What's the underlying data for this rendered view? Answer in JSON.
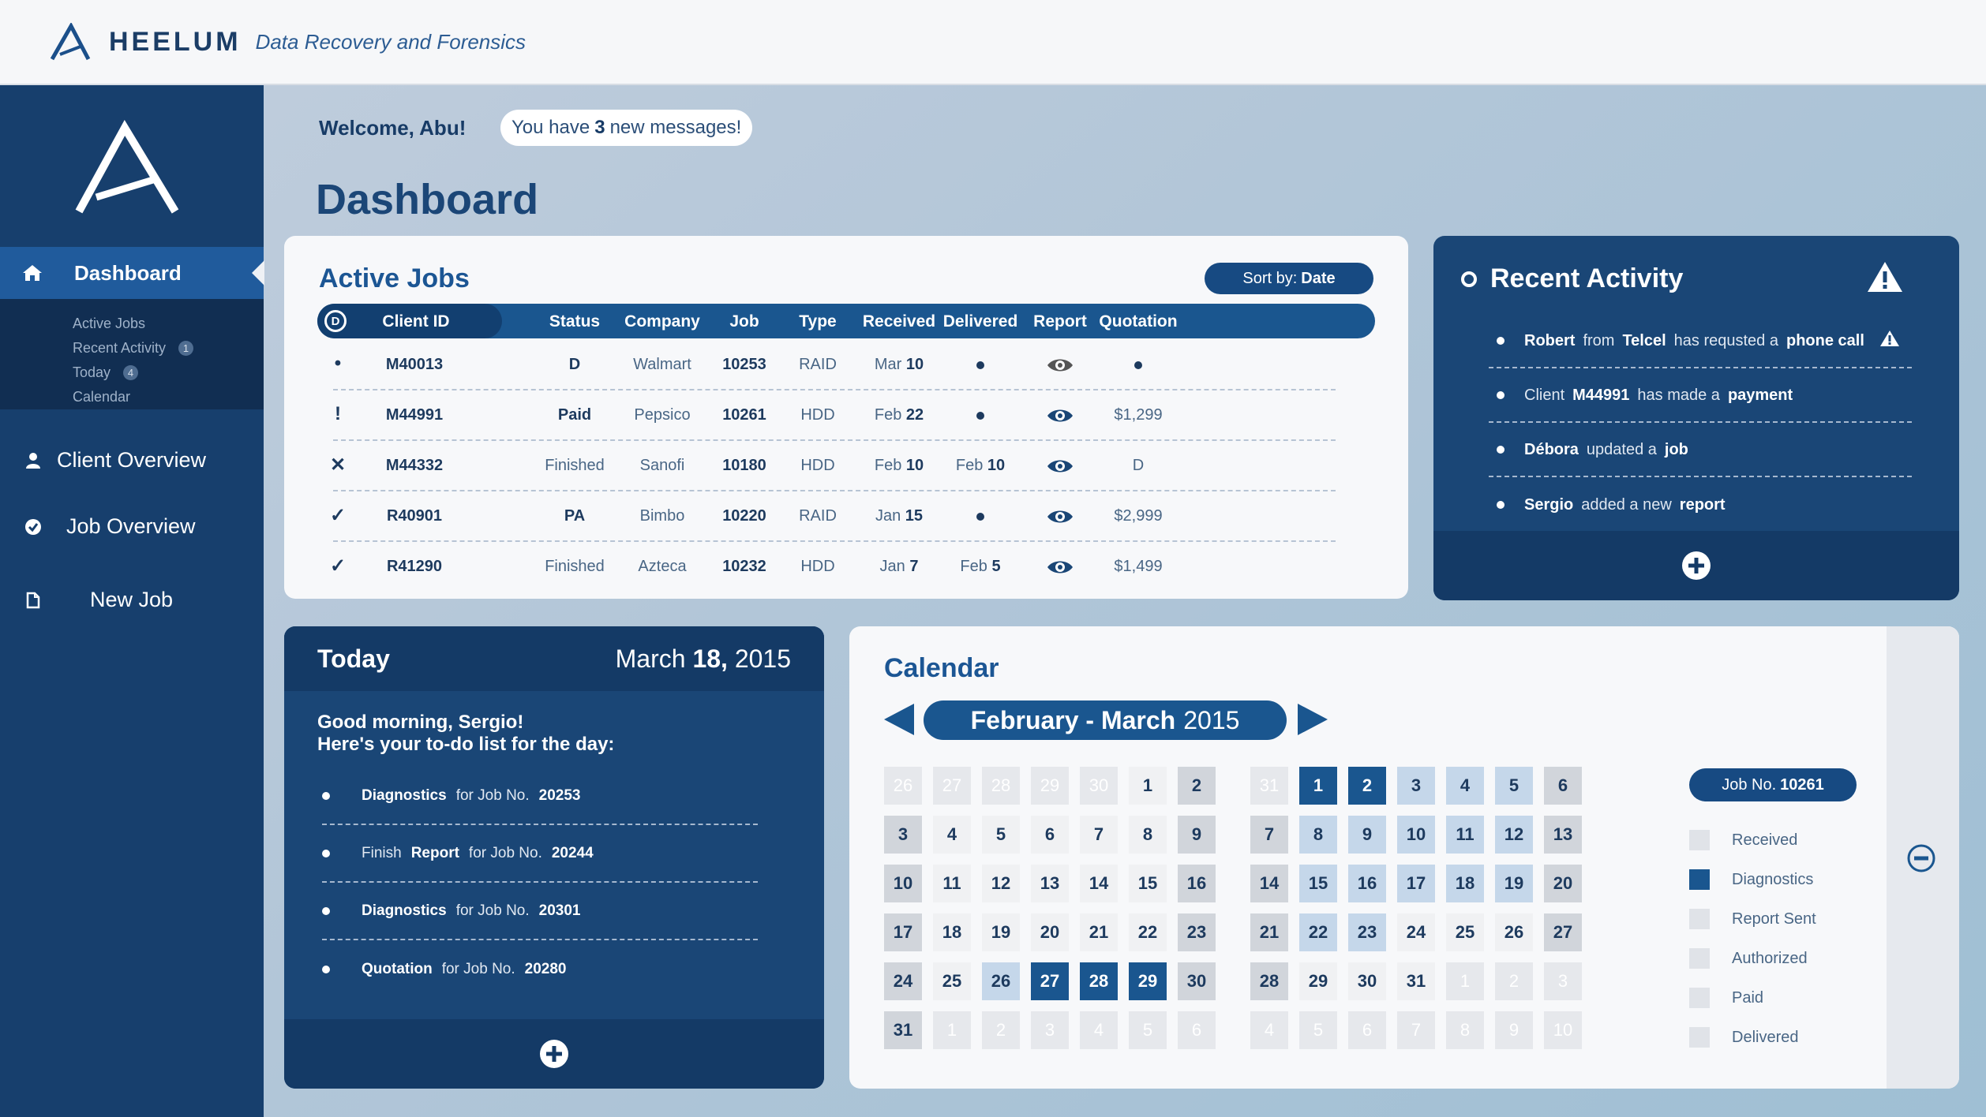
{
  "app": {
    "brand": "HEELUM",
    "tagline": "Data Recovery and Forensics"
  },
  "colors": {
    "primary": "#173f6d",
    "accent": "#1a568f",
    "background": "#b2c6d8"
  },
  "sidebar": {
    "active": {
      "label": "Dashboard",
      "icon": "home-icon"
    },
    "subitems": [
      {
        "label": "Active Jobs",
        "badge": ""
      },
      {
        "label": "Recent Activity",
        "badge": "1"
      },
      {
        "label": "Today",
        "badge": "4"
      },
      {
        "label": "Calendar",
        "badge": ""
      }
    ],
    "items": [
      {
        "label": "Client Overview",
        "icon": "user-icon"
      },
      {
        "label": "Job Overview",
        "icon": "check-circle-icon"
      },
      {
        "label": "New Job",
        "icon": "new-file-icon"
      }
    ]
  },
  "header": {
    "welcome": "Welcome, Abu!",
    "messages_prefix": "You have",
    "messages_count": "3",
    "messages_suffix": "new messages!",
    "title": "Dashboard"
  },
  "active_jobs": {
    "title": "Active Jobs",
    "sort_label": "Sort by:",
    "sort_value": "Date",
    "filter_badge": "D",
    "columns": [
      "Client ID",
      "Status",
      "Company",
      "Job",
      "Type",
      "Received",
      "Delivered",
      "Report",
      "Quotation"
    ],
    "rows": [
      {
        "marker": "•",
        "client": "M40013",
        "status": "D",
        "company": "Walmart",
        "job": "10253",
        "type": "RAID",
        "received_month": "Mar",
        "received_day": "10",
        "delivered_month": "",
        "delivered_day": "",
        "delivered_dot": true,
        "quotation": "",
        "quotation_dot": true
      },
      {
        "marker": "!",
        "client": "M44991",
        "status": "Paid",
        "company": "Pepsico",
        "job": "10261",
        "type": "HDD",
        "received_month": "Feb",
        "received_day": "22",
        "delivered_month": "",
        "delivered_day": "",
        "delivered_dot": true,
        "quotation": "$1,299",
        "quotation_dot": false
      },
      {
        "marker": "✕",
        "client": "M44332",
        "status": "Finished",
        "company": "Sanofi",
        "job": "10180",
        "type": "HDD",
        "received_month": "Feb",
        "received_day": "10",
        "delivered_month": "Feb",
        "delivered_day": "10",
        "delivered_dot": false,
        "quotation": "D",
        "quotation_dot": false
      },
      {
        "marker": "✓",
        "client": "R40901",
        "status": "PA",
        "company": "Bimbo",
        "job": "10220",
        "type": "RAID",
        "received_month": "Jan",
        "received_day": "15",
        "delivered_month": "",
        "delivered_day": "",
        "delivered_dot": true,
        "quotation": "$2,999",
        "quotation_dot": false
      },
      {
        "marker": "✓",
        "client": "R41290",
        "status": "Finished",
        "company": "Azteca",
        "job": "10232",
        "type": "HDD",
        "received_month": "Jan",
        "received_day": "7",
        "delivered_month": "Feb",
        "delivered_day": "5",
        "delivered_dot": false,
        "quotation": "$1,499",
        "quotation_dot": false
      }
    ]
  },
  "recent_activity": {
    "title": "Recent Activity",
    "items": [
      {
        "parts": [
          {
            "t": "Robert",
            "b": true
          },
          {
            "t": "from",
            "b": false
          },
          {
            "t": "Telcel",
            "b": true
          },
          {
            "t": "has requsted a",
            "b": false
          },
          {
            "t": "phone call",
            "b": true
          }
        ],
        "warning": true
      },
      {
        "parts": [
          {
            "t": "Client",
            "b": false
          },
          {
            "t": "M44991",
            "b": true
          },
          {
            "t": "has made a",
            "b": false
          },
          {
            "t": "payment",
            "b": true
          }
        ],
        "warning": false
      },
      {
        "parts": [
          {
            "t": "Débora",
            "b": true
          },
          {
            "t": "updated a",
            "b": false
          },
          {
            "t": "job",
            "b": true
          }
        ],
        "warning": false
      },
      {
        "parts": [
          {
            "t": "Sergio",
            "b": true
          },
          {
            "t": "added a new",
            "b": false
          },
          {
            "t": "report",
            "b": true
          }
        ],
        "warning": false
      }
    ]
  },
  "today": {
    "title": "Today",
    "date_month": "March",
    "date_day": "18,",
    "date_year": "2015",
    "greeting_line1": "Good morning, Sergio!",
    "greeting_line2": "Here's your to-do list for the day:",
    "todos": [
      {
        "parts": [
          {
            "t": "Diagnostics",
            "b": true
          },
          {
            "t": "for Job No.",
            "b": false
          },
          {
            "t": "20253",
            "b": true
          }
        ]
      },
      {
        "parts": [
          {
            "t": "Finish",
            "b": false
          },
          {
            "t": "Report",
            "b": true
          },
          {
            "t": "for Job No.",
            "b": false
          },
          {
            "t": "20244",
            "b": true
          }
        ]
      },
      {
        "parts": [
          {
            "t": "Diagnostics",
            "b": true
          },
          {
            "t": "for Job No.",
            "b": false
          },
          {
            "t": "20301",
            "b": true
          }
        ]
      },
      {
        "parts": [
          {
            "t": "Quotation",
            "b": true
          },
          {
            "t": "for Job No.",
            "b": false
          },
          {
            "t": "20280",
            "b": true
          }
        ]
      }
    ]
  },
  "calendar": {
    "title": "Calendar",
    "month_label": "February - March",
    "year": "2015",
    "grids": [
      [
        [
          {
            "d": "26",
            "s": "l"
          },
          {
            "d": "27",
            "s": "l"
          },
          {
            "d": "28",
            "s": "l"
          },
          {
            "d": "29",
            "s": "l"
          },
          {
            "d": "30",
            "s": "l"
          },
          {
            "d": "1",
            "s": "w"
          },
          {
            "d": "2",
            "s": "g"
          }
        ],
        [
          {
            "d": "3",
            "s": "g"
          },
          {
            "d": "4",
            "s": "w"
          },
          {
            "d": "5",
            "s": "w"
          },
          {
            "d": "6",
            "s": "w"
          },
          {
            "d": "7",
            "s": "w"
          },
          {
            "d": "8",
            "s": "w"
          },
          {
            "d": "9",
            "s": "g"
          }
        ],
        [
          {
            "d": "10",
            "s": "g"
          },
          {
            "d": "11",
            "s": "w"
          },
          {
            "d": "12",
            "s": "w"
          },
          {
            "d": "13",
            "s": "w"
          },
          {
            "d": "14",
            "s": "w"
          },
          {
            "d": "15",
            "s": "w"
          },
          {
            "d": "16",
            "s": "g"
          }
        ],
        [
          {
            "d": "17",
            "s": "g"
          },
          {
            "d": "18",
            "s": "w"
          },
          {
            "d": "19",
            "s": "w"
          },
          {
            "d": "20",
            "s": "w"
          },
          {
            "d": "21",
            "s": "w"
          },
          {
            "d": "22",
            "s": "w"
          },
          {
            "d": "23",
            "s": "g"
          }
        ],
        [
          {
            "d": "24",
            "s": "g"
          },
          {
            "d": "25",
            "s": "w"
          },
          {
            "d": "26",
            "s": "p"
          },
          {
            "d": "27",
            "s": "d"
          },
          {
            "d": "28",
            "s": "d"
          },
          {
            "d": "29",
            "s": "d"
          },
          {
            "d": "30",
            "s": "g"
          }
        ],
        [
          {
            "d": "31",
            "s": "g"
          },
          {
            "d": "1",
            "s": "l"
          },
          {
            "d": "2",
            "s": "l"
          },
          {
            "d": "3",
            "s": "l"
          },
          {
            "d": "4",
            "s": "l"
          },
          {
            "d": "5",
            "s": "l"
          },
          {
            "d": "6",
            "s": "l"
          }
        ]
      ],
      [
        [
          {
            "d": "31",
            "s": "l"
          },
          {
            "d": "1",
            "s": "d"
          },
          {
            "d": "2",
            "s": "d"
          },
          {
            "d": "3",
            "s": "p"
          },
          {
            "d": "4",
            "s": "p"
          },
          {
            "d": "5",
            "s": "p"
          },
          {
            "d": "6",
            "s": "g"
          }
        ],
        [
          {
            "d": "7",
            "s": "g"
          },
          {
            "d": "8",
            "s": "p"
          },
          {
            "d": "9",
            "s": "p"
          },
          {
            "d": "10",
            "s": "p"
          },
          {
            "d": "11",
            "s": "p"
          },
          {
            "d": "12",
            "s": "p"
          },
          {
            "d": "13",
            "s": "g"
          }
        ],
        [
          {
            "d": "14",
            "s": "g"
          },
          {
            "d": "15",
            "s": "p"
          },
          {
            "d": "16",
            "s": "p"
          },
          {
            "d": "17",
            "s": "p"
          },
          {
            "d": "18",
            "s": "p"
          },
          {
            "d": "19",
            "s": "p"
          },
          {
            "d": "20",
            "s": "g"
          }
        ],
        [
          {
            "d": "21",
            "s": "g"
          },
          {
            "d": "22",
            "s": "p"
          },
          {
            "d": "23",
            "s": "p"
          },
          {
            "d": "24",
            "s": "w"
          },
          {
            "d": "25",
            "s": "w"
          },
          {
            "d": "26",
            "s": "w"
          },
          {
            "d": "27",
            "s": "g"
          }
        ],
        [
          {
            "d": "28",
            "s": "g"
          },
          {
            "d": "29",
            "s": "w"
          },
          {
            "d": "30",
            "s": "w"
          },
          {
            "d": "31",
            "s": "w"
          },
          {
            "d": "1",
            "s": "l"
          },
          {
            "d": "2",
            "s": "l"
          },
          {
            "d": "3",
            "s": "l"
          }
        ],
        [
          {
            "d": "4",
            "s": "l"
          },
          {
            "d": "5",
            "s": "l"
          },
          {
            "d": "6",
            "s": "l"
          },
          {
            "d": "7",
            "s": "l"
          },
          {
            "d": "8",
            "s": "l"
          },
          {
            "d": "9",
            "s": "l"
          },
          {
            "d": "10",
            "s": "l"
          }
        ]
      ]
    ],
    "job_label": "Job No.",
    "job_number": "10261",
    "legend": [
      {
        "label": "Received",
        "active": false
      },
      {
        "label": "Diagnostics",
        "active": true
      },
      {
        "label": "Report Sent",
        "active": false
      },
      {
        "label": "Authorized",
        "active": false
      },
      {
        "label": "Paid",
        "active": false
      },
      {
        "label": "Delivered",
        "active": false
      }
    ]
  }
}
